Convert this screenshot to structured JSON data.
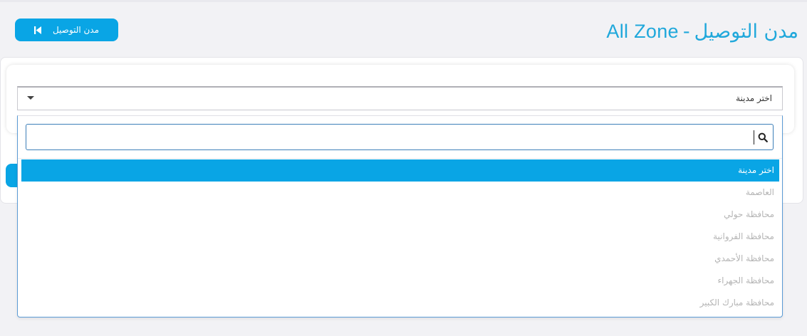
{
  "header": {
    "title_en": "All Zone",
    "title_separator": "-",
    "title_ar": "مدن التوصيل",
    "back_button_label": "مدن التوصيل"
  },
  "city_select": {
    "selected_label": "اختر مدينة",
    "search_placeholder": "",
    "options": [
      {
        "label": "اختر مدينة"
      },
      {
        "label": "العاصمة"
      },
      {
        "label": "محافظة حولي"
      },
      {
        "label": "محافظة الفروانية"
      },
      {
        "label": "محافظة الأحمدي"
      },
      {
        "label": "محافظة الجهراء"
      },
      {
        "label": "محافظة مبارك الكبير"
      }
    ]
  },
  "icons": {
    "back": "skip-back-icon",
    "caret": "caret-down-icon",
    "search": "search-icon"
  },
  "colors": {
    "accent": "#09a5e5",
    "title": "#20a8db",
    "background": "#f2f2f5",
    "option_text": "#b5b5b5",
    "selected_option_text": "#ffffff"
  }
}
